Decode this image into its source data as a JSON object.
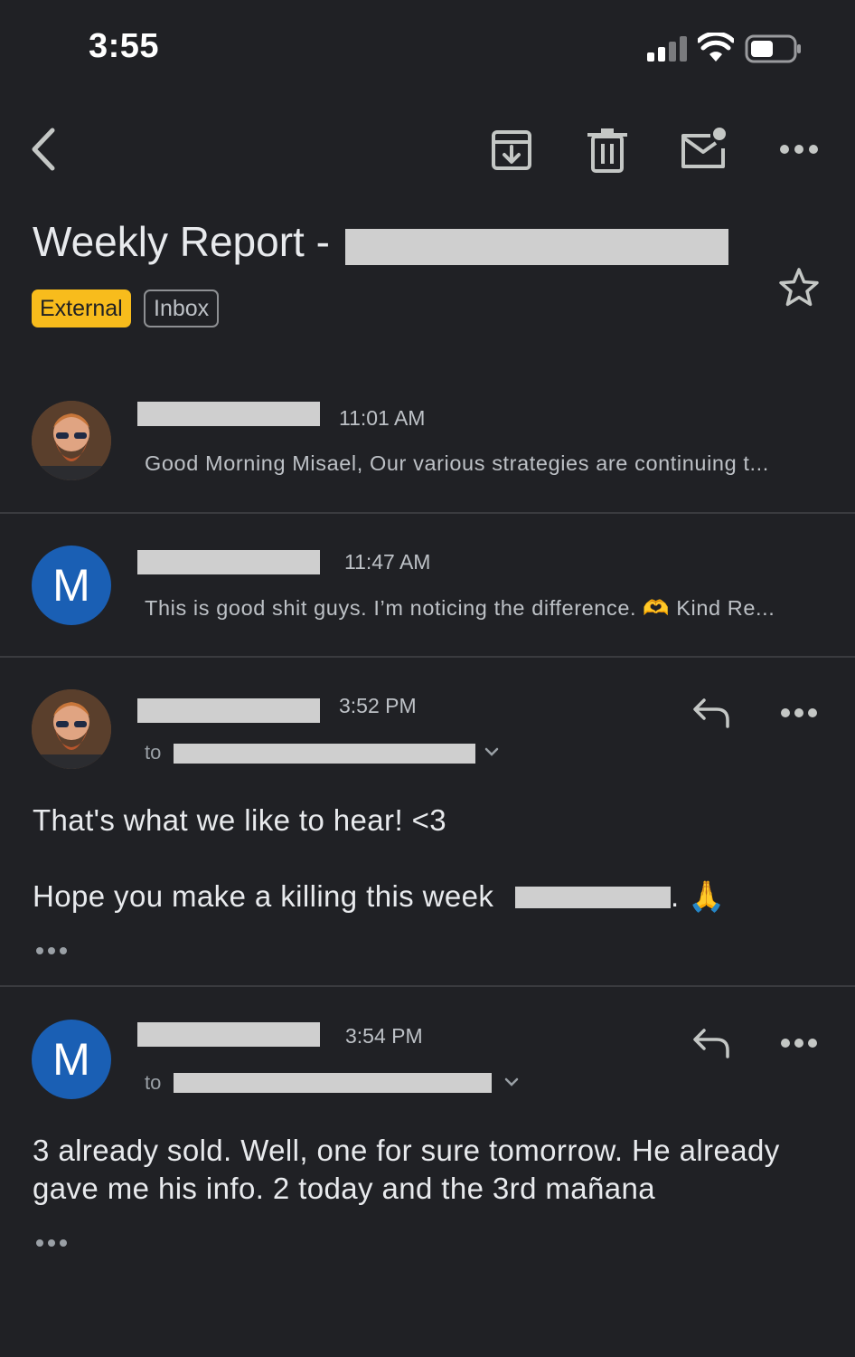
{
  "status_bar": {
    "time": "3:55"
  },
  "subject": {
    "text": "Weekly Report -"
  },
  "labels": {
    "external": "External",
    "inbox": "Inbox"
  },
  "messages": [
    {
      "time": "11:01 AM",
      "snippet": "Good Morning Misael, Our various strategies are continuing t..."
    },
    {
      "avatar_letter": "M",
      "time": "11:47 AM",
      "snippet": "This is good shit guys. I’m noticing the difference. 🫶 Kind Re..."
    },
    {
      "time": "3:52 PM",
      "to_label": "to",
      "body_line1": "That's what we like to hear! <3",
      "body_line2": "Hope you make a killing this week",
      "body_line2_end": ". 🙏"
    },
    {
      "avatar_letter": "M",
      "time": "3:54 PM",
      "to_label": "to",
      "body_line1": "3 already sold. Well, one for sure tomorrow. He already",
      "body_line2": "gave me his info.  2 today and the 3rd mañana"
    }
  ],
  "icons": [
    "back-icon",
    "archive-icon",
    "delete-icon",
    "mark-unread-icon",
    "more-icon",
    "star-icon",
    "reply-icon",
    "chevron-down-icon",
    "signal-icon",
    "wifi-icon",
    "battery-icon"
  ],
  "colors": {
    "background": "#202125",
    "external_chip": "#f8bc1c",
    "avatar_m": "#1a5fb4"
  }
}
